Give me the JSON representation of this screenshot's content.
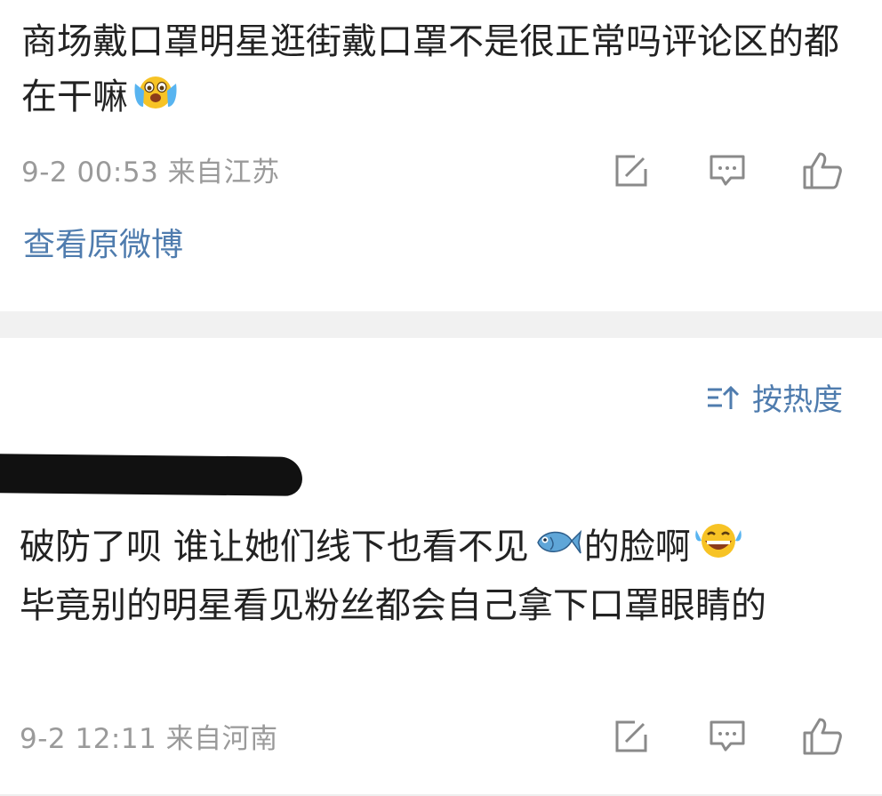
{
  "post": {
    "text_part1": "商场戴口罩明星逛街戴口罩不是很正常吗评论区的都在干嘛",
    "emoji": "crying-face",
    "meta": "9-2 00:53 来自江苏",
    "view_original": "查看原微博"
  },
  "comments": {
    "sort_label": "按热度",
    "items": [
      {
        "text_a": "破防了呗 谁让她们线下也看不见",
        "emoji_fish": "fish",
        "text_b": "的脸啊",
        "emoji_laugh": "laughing-face",
        "text_c": "毕竟别的明星看见粉丝都会自己拿下口罩眼睛的",
        "meta": "9-2 12:11 来自河南"
      }
    ]
  },
  "colors": {
    "link_blue": "#4f7cae",
    "meta_gray": "#9a9a9a",
    "divider_bg": "#f1f1f1"
  }
}
